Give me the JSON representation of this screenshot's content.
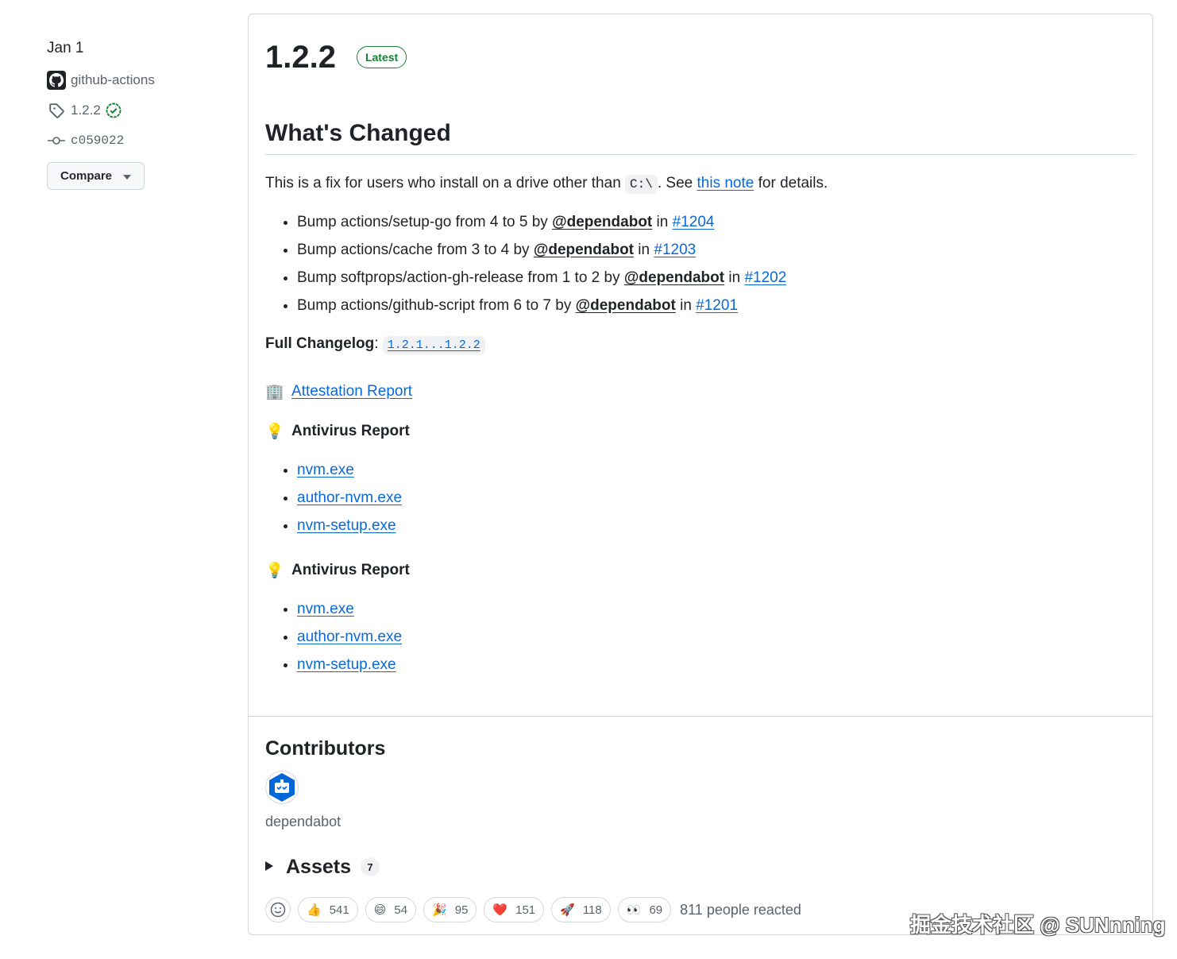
{
  "sidebar": {
    "date": "Jan 1",
    "author": "github-actions",
    "tag": "1.2.2",
    "commit": "c059022",
    "compare_label": "Compare"
  },
  "release": {
    "title": "1.2.2",
    "badge": "Latest",
    "heading": "What's Changed",
    "intro": {
      "before": "This is a fix for users who install on a drive other than ",
      "code": "C:\\",
      "middle": ". See ",
      "link": "this note",
      "after": " for details."
    },
    "bumps": [
      {
        "text": "Bump actions/setup-go from 4 to 5 by ",
        "user": "@dependabot",
        "in": " in ",
        "pr": "#1204"
      },
      {
        "text": "Bump actions/cache from 3 to 4 by ",
        "user": "@dependabot",
        "in": " in ",
        "pr": "#1203"
      },
      {
        "text": "Bump softprops/action-gh-release from 1 to 2 by ",
        "user": "@dependabot",
        "in": " in ",
        "pr": "#1202"
      },
      {
        "text": "Bump actions/github-script from 6 to 7 by ",
        "user": "@dependabot",
        "in": " in ",
        "pr": "#1201"
      }
    ],
    "changelog_label": "Full Changelog",
    "changelog_sep": ": ",
    "changelog_link": "1.2.1...1.2.2",
    "attestation": {
      "emoji": "🏢",
      "label": "Attestation Report"
    },
    "antivirus_sections": [
      {
        "emoji": "💡",
        "label": "Antivirus Report",
        "files": [
          "nvm.exe",
          "author-nvm.exe",
          "nvm-setup.exe"
        ]
      },
      {
        "emoji": "💡",
        "label": "Antivirus Report",
        "files": [
          "nvm.exe",
          "author-nvm.exe",
          "nvm-setup.exe"
        ]
      }
    ]
  },
  "contributors": {
    "heading": "Contributors",
    "name": "dependabot"
  },
  "assets": {
    "label": "Assets",
    "count": "7"
  },
  "reactions": {
    "items": [
      {
        "emoji": "👍",
        "count": "541"
      },
      {
        "emoji": "😄",
        "count": "54"
      },
      {
        "emoji": "🎉",
        "count": "95"
      },
      {
        "emoji": "❤️",
        "count": "151"
      },
      {
        "emoji": "🚀",
        "count": "118"
      },
      {
        "emoji": "👀",
        "count": "69"
      }
    ],
    "summary": "811 people reacted"
  },
  "watermark": "掘金技术社区 @ SUNnning",
  "colors": {
    "link": "#0969da",
    "success": "#1a7f37",
    "border": "#d1d9e0",
    "text": "#1f2328",
    "muted": "#59636e",
    "dependabot_blue": "#0366d6"
  }
}
